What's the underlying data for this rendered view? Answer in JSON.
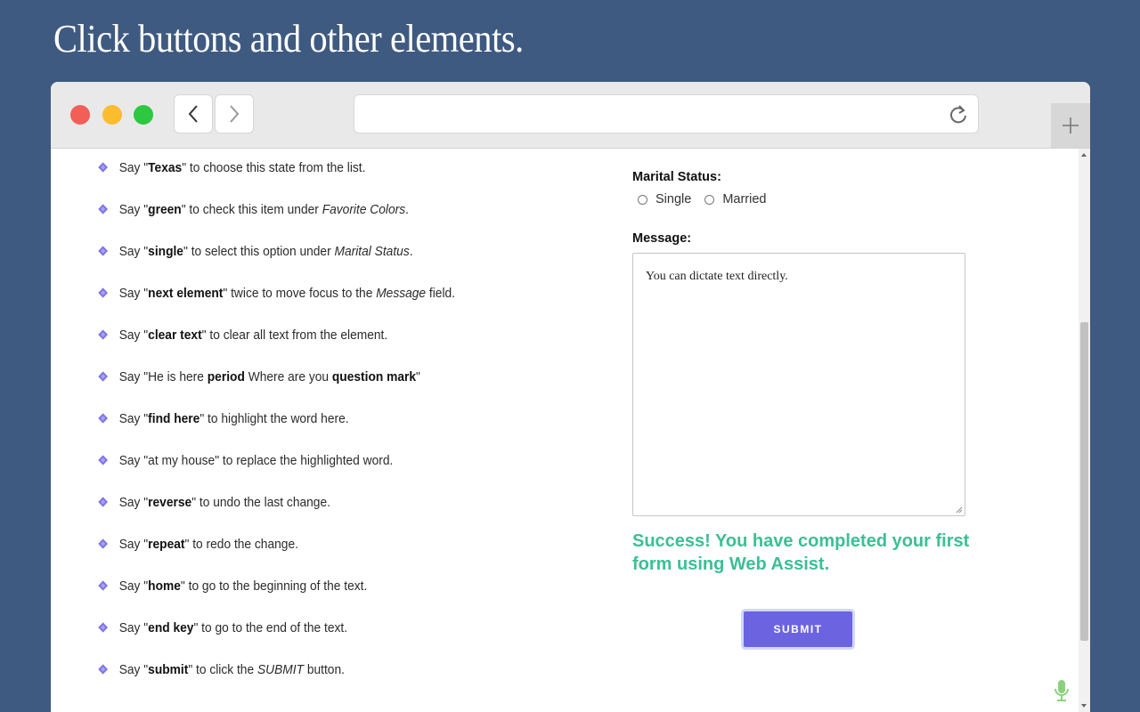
{
  "headline": "Click buttons and other elements.",
  "browser": {
    "back_icon": "chevron-left-icon",
    "forward_icon": "chevron-right-icon",
    "reload_icon": "reload-icon",
    "new_tab_icon": "plus-icon",
    "address_value": ""
  },
  "instructions": [
    {
      "pre": "Say \"",
      "bold": "Texas",
      "mid": "\" to choose this state from the list.",
      "italic": "",
      "post": ""
    },
    {
      "pre": "Say \"",
      "bold": "green",
      "mid": "\" to check this item under ",
      "italic": "Favorite Colors",
      "post": "."
    },
    {
      "pre": "Say \"",
      "bold": "single",
      "mid": "\" to select this option under ",
      "italic": "Marital Status",
      "post": "."
    },
    {
      "pre": "Say \"",
      "bold": "next element",
      "mid": "\" twice to move focus to the ",
      "italic": "Message",
      "post": " field."
    },
    {
      "pre": "Say \"",
      "bold": "clear text",
      "mid": "\" to clear all text from the element.",
      "italic": "",
      "post": ""
    },
    {
      "pre": "Say \"He is here ",
      "bold": "period",
      "mid": " Where are you ",
      "bold2": "question mark",
      "post": "\""
    },
    {
      "pre": "Say \"",
      "bold": "find here",
      "mid": "\" to highlight the word here.",
      "italic": "",
      "post": ""
    },
    {
      "pre": "Say \"at my house\" to replace the highlighted word.",
      "bold": "",
      "mid": "",
      "italic": "",
      "post": ""
    },
    {
      "pre": "Say \"",
      "bold": "reverse",
      "mid": "\" to undo the last change.",
      "italic": "",
      "post": ""
    },
    {
      "pre": "Say \"",
      "bold": "repeat",
      "mid": "\" to redo the change.",
      "italic": "",
      "post": ""
    },
    {
      "pre": "Say \"",
      "bold": "home",
      "mid": "\" to go to the beginning of the text.",
      "italic": "",
      "post": ""
    },
    {
      "pre": "Say \"",
      "bold": "end key",
      "mid": "\" to go to the end of the text.",
      "italic": "",
      "post": ""
    },
    {
      "pre": "Say \"",
      "bold": "submit",
      "mid": "\" to click the ",
      "italic": "SUBMIT",
      "post": " button."
    }
  ],
  "form": {
    "marital_label": "Marital Status:",
    "options": [
      "Single",
      "Married"
    ],
    "message_label": "Message:",
    "message_value": "You can dictate text directly.",
    "success_text": "Success! You have completed your first form using Web Assist.",
    "submit_label": "SUBMIT"
  },
  "colors": {
    "background": "#3f5a80",
    "accent": "#6c63e0",
    "success": "#3cbf94",
    "bullet": "#7b73e6"
  }
}
